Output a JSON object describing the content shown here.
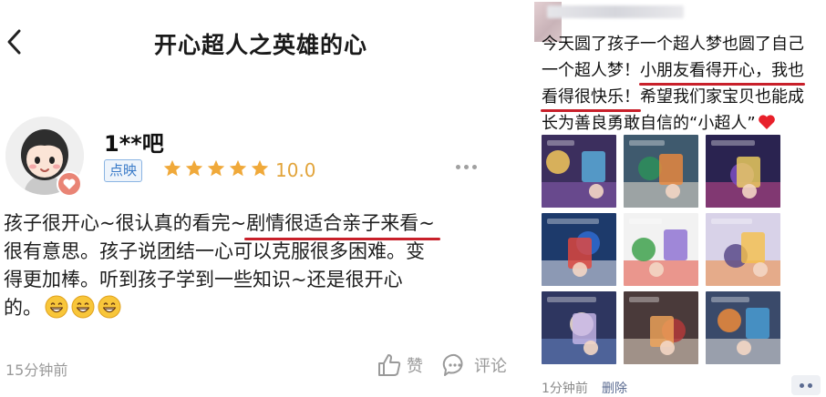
{
  "left_review": {
    "nav": {
      "title": "开心超人之英雄的心",
      "back_icon": "chevron-left-icon"
    },
    "reviewer": {
      "username": "1**吧",
      "platform_tag": "点映",
      "rating_stars": 5,
      "rating_max": 5,
      "score": "10.0",
      "badge_icon": "heart-icon"
    },
    "review": {
      "line1_pre": "孩子很开心~很认真的看完~",
      "line1_highlight": "剧情很适合亲子来看~",
      "line2": "很有意思。孩子说团结一心可以克服很多困难。变",
      "line3": "得更加棒。听到孩子学到一些知识~还是很开心",
      "line4": "的。",
      "emoji_count": 3,
      "emoji_icon": "grinning-face-icon"
    },
    "footer": {
      "time": "15分钟前",
      "like_label": "赞",
      "comment_label": "评论",
      "like_icon": "thumbs-up-icon",
      "comment_icon": "comment-bubble-icon"
    },
    "colors": {
      "highlight_underline": "#c8202a",
      "star": "#f0a93a",
      "score": "#e2a43a",
      "tag_text": "#3a7bc8"
    }
  },
  "right_moment": {
    "post": {
      "line1": "今天圆了孩子一个超人梦也圆了自己",
      "line2_pre": "一个超人梦！",
      "line2_highlight": "小朋友看得开心，我也",
      "line3_highlight": "看得很快乐！",
      "line3_post": "希望我们家宝贝也能成",
      "line4": "长为善良勇敢自信的“小超人”",
      "end_icon": "red-heart-icon"
    },
    "photos": [
      {
        "id": "photo-1",
        "theme": "cinema-lobby"
      },
      {
        "id": "photo-2",
        "theme": "kids-with-poster"
      },
      {
        "id": "photo-3",
        "theme": "theater-audience"
      },
      {
        "id": "photo-4",
        "theme": "event-banner"
      },
      {
        "id": "photo-5",
        "theme": "event-poster-screen"
      },
      {
        "id": "photo-6",
        "theme": "character-cutout"
      },
      {
        "id": "photo-7",
        "theme": "child-with-mascot"
      },
      {
        "id": "photo-8",
        "theme": "hands-with-props"
      },
      {
        "id": "photo-9",
        "theme": "child-in-lobby"
      }
    ],
    "footer": {
      "time": "1分钟前",
      "delete_label": "删除",
      "more_icon": "more-dots-icon"
    }
  }
}
